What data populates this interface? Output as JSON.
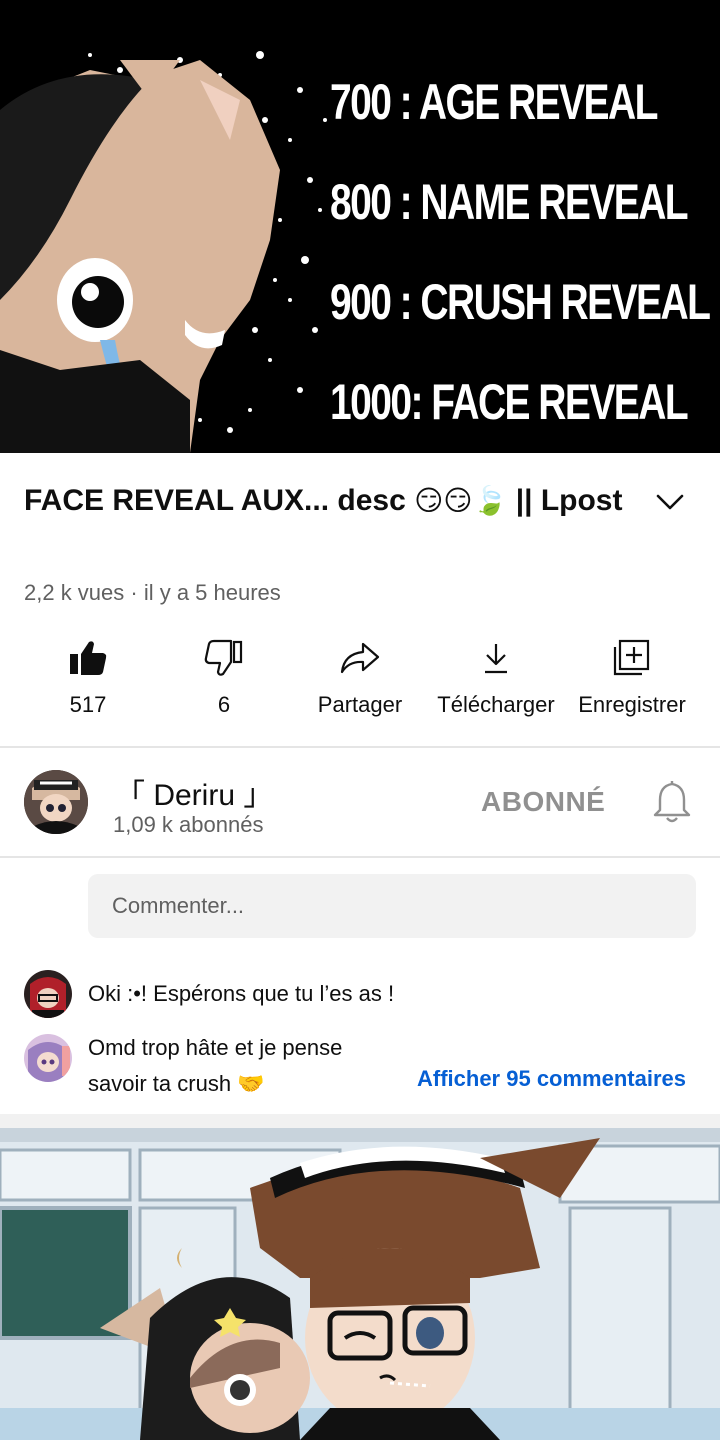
{
  "player": {
    "reveal_lines": [
      "700 : AGE REVEAL",
      "800 : NAME REVEAL",
      "900 : CRUSH REVEAL",
      "1000: FACE REVEAL"
    ]
  },
  "video": {
    "title_text": "FACE REVEAL AUX... desc ",
    "title_emojis": "😏😏🍃",
    "title_suffix": " || Lpost",
    "meta": "2,2 k vues · il y a 5 heures"
  },
  "actions": {
    "like": {
      "label": "517",
      "icon": "thumbs-up-filled-icon"
    },
    "dislike": {
      "label": "6",
      "icon": "thumbs-down-icon"
    },
    "share": {
      "label": "Partager",
      "icon": "share-arrow-icon"
    },
    "download": {
      "label": "Télécharger",
      "icon": "download-icon"
    },
    "save": {
      "label": "Enregistrer",
      "icon": "add-to-playlist-icon"
    }
  },
  "channel": {
    "name": "「 Deriru 」",
    "subscribers": "1,09 k abonnés",
    "subscribe_state": "ABONNÉ",
    "bell_icon": "notification-bell-icon"
  },
  "comments": {
    "placeholder": "Commenter...",
    "items": [
      {
        "text": "Oki :•! Espérons que tu l’es as !"
      },
      {
        "text_line1": "Omd trop hâte et je pense",
        "text_line2": "savoir ta crush 🤝"
      }
    ],
    "show_all": "Afficher 95 commentaires"
  },
  "colors": {
    "link_blue": "#065fd4",
    "secondary_text": "#606060",
    "subscribed_gray": "#909090"
  }
}
